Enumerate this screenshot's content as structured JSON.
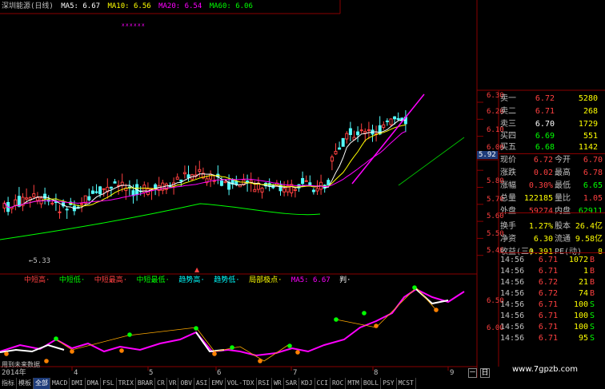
{
  "title": "深圳能源(日线)",
  "ma_legend": [
    {
      "label": "MA5: 6.67",
      "color": "#ffffff"
    },
    {
      "label": "MA10: 6.56",
      "color": "#ffff00"
    },
    {
      "label": "MA20: 6.54",
      "color": "#ff00ff"
    },
    {
      "label": "MA60: 6.06",
      "color": "#00ff00"
    }
  ],
  "price_axis": [
    "6.30",
    "6.20",
    "6.10",
    "6.00",
    "5.92",
    "5.80",
    "5.70",
    "5.60",
    "5.50",
    "5.40"
  ],
  "current_price_tag": "5.92",
  "low_marker": "5.33",
  "indicator_legend": [
    {
      "label": "中短高·",
      "color": "#ff4040"
    },
    {
      "label": "中短低·",
      "color": "#00ff00"
    },
    {
      "label": "中短最高·",
      "color": "#ff4040"
    },
    {
      "label": "中短最低·",
      "color": "#00ff00"
    },
    {
      "label": "趋势高·",
      "color": "#00ffff"
    },
    {
      "label": "趋势低·",
      "color": "#00ffff"
    },
    {
      "label": "局部极点·",
      "color": "#ffff00"
    },
    {
      "label": "MA5: 6.67",
      "color": "#ff00ff"
    },
    {
      "label": "判·",
      "color": "#ffffff"
    }
  ],
  "indicator_axis": [
    "6.50",
    "6.00"
  ],
  "dates": [
    "2014年",
    "4",
    "5",
    "6",
    "7",
    "8",
    "9"
  ],
  "status_label": "用到未来数据",
  "quotes": [
    {
      "label": "卖一",
      "price": "6.72",
      "vol": "5280",
      "color": "#ff4040"
    },
    {
      "label": "卖二",
      "price": "6.71",
      "vol": "268",
      "color": "#ff4040"
    },
    {
      "label": "卖三",
      "price": "6.70",
      "vol": "1729",
      "color": "#ffffff"
    },
    {
      "label": "买四",
      "price": "6.69",
      "vol": "551",
      "color": "#00ff00"
    },
    {
      "label": "买五",
      "price": "6.68",
      "vol": "1142",
      "color": "#00ff00"
    }
  ],
  "stats": [
    {
      "l1": "现价",
      "v1": "6.72",
      "c1": "#ff4040",
      "l2": "今开",
      "v2": "6.70",
      "c2": "#ff4040"
    },
    {
      "l1": "涨跌",
      "v1": "0.02",
      "c1": "#ff4040",
      "l2": "最高",
      "v2": "6.78",
      "c2": "#ff4040"
    },
    {
      "l1": "涨幅",
      "v1": "0.30%",
      "c1": "#ff4040",
      "l2": "最低",
      "v2": "6.65",
      "c2": "#00ff00"
    },
    {
      "l1": "总量",
      "v1": "122185",
      "c1": "#ffff00",
      "l2": "量比",
      "v2": "1.05",
      "c2": "#ff4040"
    },
    {
      "l1": "外盘",
      "v1": "59274",
      "c1": "#ff4040",
      "l2": "内盘",
      "v2": "62911",
      "c2": "#00ff00"
    },
    {
      "l1": "换手",
      "v1": "1.27%",
      "c1": "#ffff00",
      "l2": "股本",
      "v2": "26.4亿",
      "c2": "#ffff00"
    },
    {
      "l1": "净资",
      "v1": "6.30",
      "c1": "#ffff00",
      "l2": "流通",
      "v2": "9.58亿",
      "c2": "#ffff00"
    },
    {
      "l1": "收益(三)",
      "v1": "0.391",
      "c1": "#ffff00",
      "l2": "PE(动)",
      "v2": "8",
      "c2": "#ffff00"
    }
  ],
  "ticks": [
    {
      "time": "14:56",
      "price": "6.71",
      "vol": "1072",
      "dir": "B",
      "pc": "#ff4040",
      "dc": "#ff4040"
    },
    {
      "time": "14:56",
      "price": "6.71",
      "vol": "1",
      "dir": "B",
      "pc": "#ff4040",
      "dc": "#ff4040"
    },
    {
      "time": "14:56",
      "price": "6.72",
      "vol": "21",
      "dir": "B",
      "pc": "#ff4040",
      "dc": "#ff4040"
    },
    {
      "time": "14:56",
      "price": "6.72",
      "vol": "74",
      "dir": "B",
      "pc": "#ff4040",
      "dc": "#ff4040"
    },
    {
      "time": "14:56",
      "price": "6.71",
      "vol": "100",
      "dir": "S",
      "pc": "#ff4040",
      "dc": "#00ff00"
    },
    {
      "time": "14:56",
      "price": "6.71",
      "vol": "100",
      "dir": "S",
      "pc": "#ff4040",
      "dc": "#00ff00"
    },
    {
      "time": "14:56",
      "price": "6.71",
      "vol": "100",
      "dir": "S",
      "pc": "#ff4040",
      "dc": "#00ff00"
    },
    {
      "time": "14:56",
      "price": "6.71",
      "vol": "95",
      "dir": "S",
      "pc": "#ff4040",
      "dc": "#00ff00"
    }
  ],
  "tabs": [
    "指标",
    "模板",
    "全部",
    "MACD",
    "DMI",
    "DMA",
    "FSL",
    "TRIX",
    "BRAR",
    "CR",
    "VR",
    "OBV",
    "ASI",
    "EMV",
    "VOL-TDX",
    "RSI",
    "WR",
    "SAR",
    "KDJ",
    "CCI",
    "ROC",
    "MTM",
    "BOLL",
    "PSY",
    "MCST"
  ],
  "active_tab": "全部",
  "watermark": "www.7gpzb.com",
  "ctrl_minus": "－",
  "ctrl_day": "日"
}
